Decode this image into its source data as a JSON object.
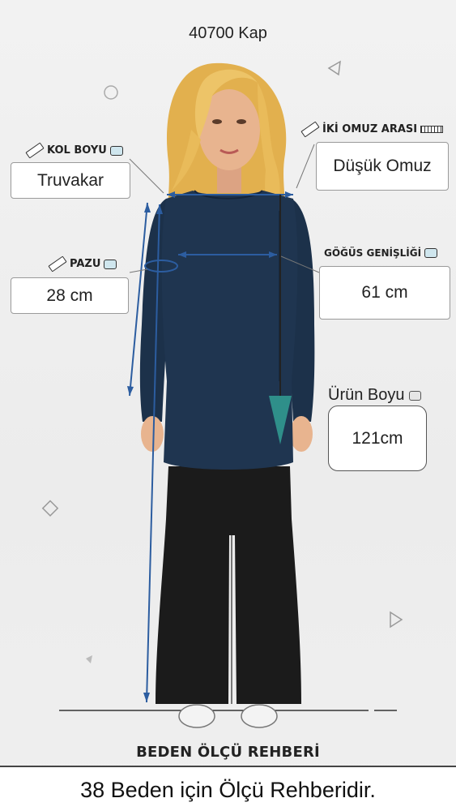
{
  "product_code": "40700 Kap",
  "labels": {
    "kol_boyu": "KOL BOYU",
    "iki_omuz": "İKİ OMUZ ARASI",
    "pazu": "PAZU",
    "gogus": "GÖĞÜS GENİŞLİĞİ",
    "urun_boyu": "Ürün Boyu"
  },
  "values": {
    "kol_boyu": "Truvakar",
    "iki_omuz": "Düşük Omuz",
    "pazu": "28 cm",
    "gogus": "61 cm",
    "urun_boyu": "121cm"
  },
  "footer_title": "BEDEN ÖLÇÜ REHBERİ",
  "caption": "38 Beden için Ölçü Rehberidir.",
  "colors": {
    "tunic": "#1f3550",
    "pants": "#1b1b1b",
    "hair": "#e2b04e",
    "skin": "#e8b48f",
    "arrow": "#2c5da0",
    "accent_arrow": "#2f8f8a"
  },
  "icons": [
    "ruler-icon",
    "measuring-tape-icon"
  ]
}
